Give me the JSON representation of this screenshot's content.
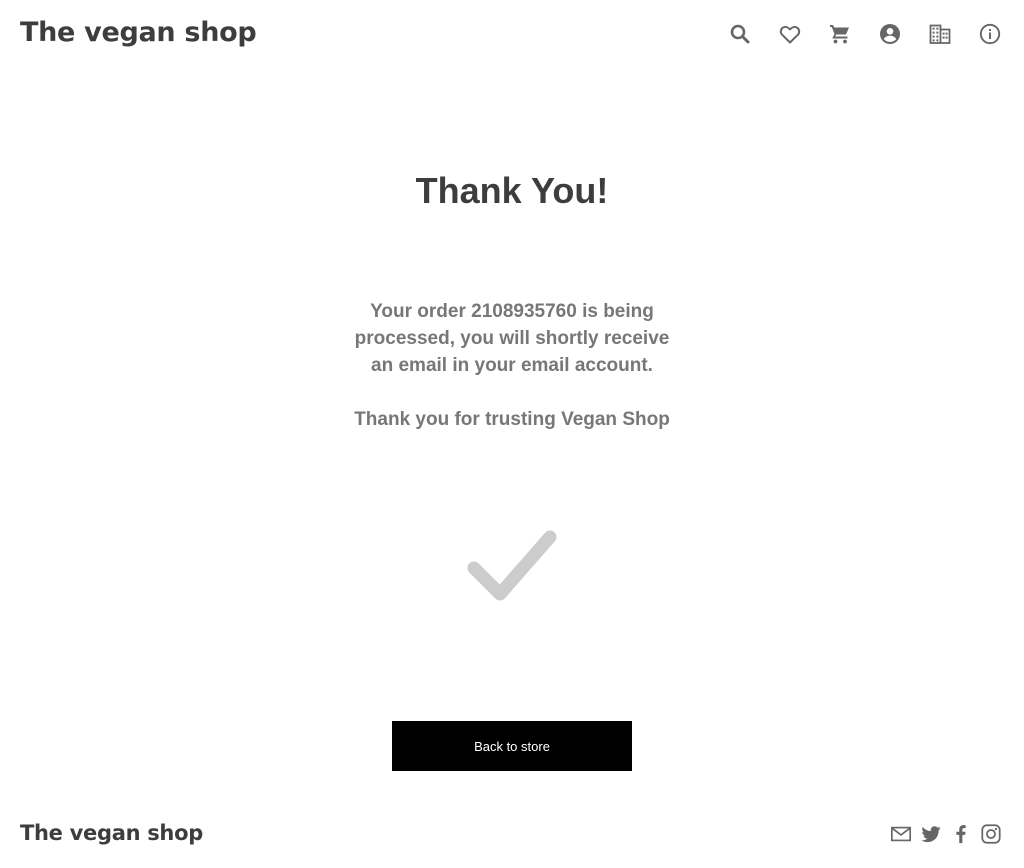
{
  "header": {
    "brand": "The vegan shop",
    "icons": [
      "search-icon",
      "heart-icon",
      "cart-icon",
      "account-icon",
      "building-icon",
      "info-icon"
    ]
  },
  "main": {
    "title": "Thank You!",
    "message_prefix": "Your order ",
    "order_number": "2108935760",
    "message_suffix": " is being processed, you will shortly receive an email in your email account.",
    "thanks": "Thank you for trusting Vegan Shop",
    "check_icon": "checkmark-icon",
    "back_button_label": "Back to store"
  },
  "footer": {
    "brand": "The vegan shop",
    "social_icons": [
      "mail-icon",
      "twitter-icon",
      "facebook-icon",
      "instagram-icon"
    ]
  },
  "colors": {
    "text_dark": "#3d3d3d",
    "text_muted": "#777777",
    "icon": "#666666",
    "checkmark": "#cccccc",
    "button_bg": "#000000",
    "button_text": "#ffffff"
  }
}
